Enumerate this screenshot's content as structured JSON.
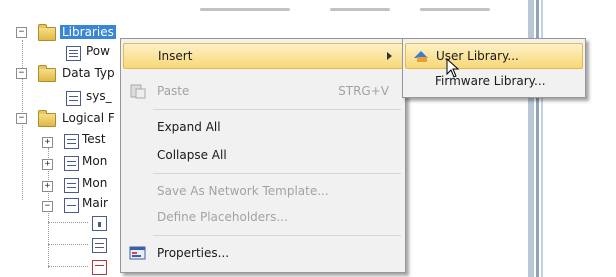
{
  "tree": {
    "items": [
      {
        "label": "Libraries",
        "selected": true
      },
      {
        "label": "Pow"
      },
      {
        "label": "Data Typ"
      },
      {
        "label": "sys_"
      },
      {
        "label": "Logical F"
      },
      {
        "label": "Test"
      },
      {
        "label": "Mon"
      },
      {
        "label": "Mon"
      },
      {
        "label": "Mair"
      }
    ]
  },
  "context_menu": {
    "items": [
      {
        "label": "Insert",
        "state": "highlighted",
        "submenu": true
      },
      {
        "label": "Paste",
        "shortcut": "STRG+V",
        "state": "disabled",
        "icon": "paste-icon"
      },
      {
        "label": "Expand All"
      },
      {
        "label": "Collapse All"
      },
      {
        "label": "Save As Network Template...",
        "state": "disabled"
      },
      {
        "label": "Define Placeholders...",
        "state": "disabled"
      },
      {
        "label": "Properties...",
        "icon": "properties-icon"
      }
    ]
  },
  "submenu": {
    "items": [
      {
        "label": "User Library...",
        "state": "highlighted",
        "icon": "user-library-icon"
      },
      {
        "label": "Firmware Library..."
      }
    ]
  },
  "colors": {
    "selection": "#3a86d6",
    "highlight": "#f8d777",
    "menu_bg": "#f1f1f1"
  }
}
